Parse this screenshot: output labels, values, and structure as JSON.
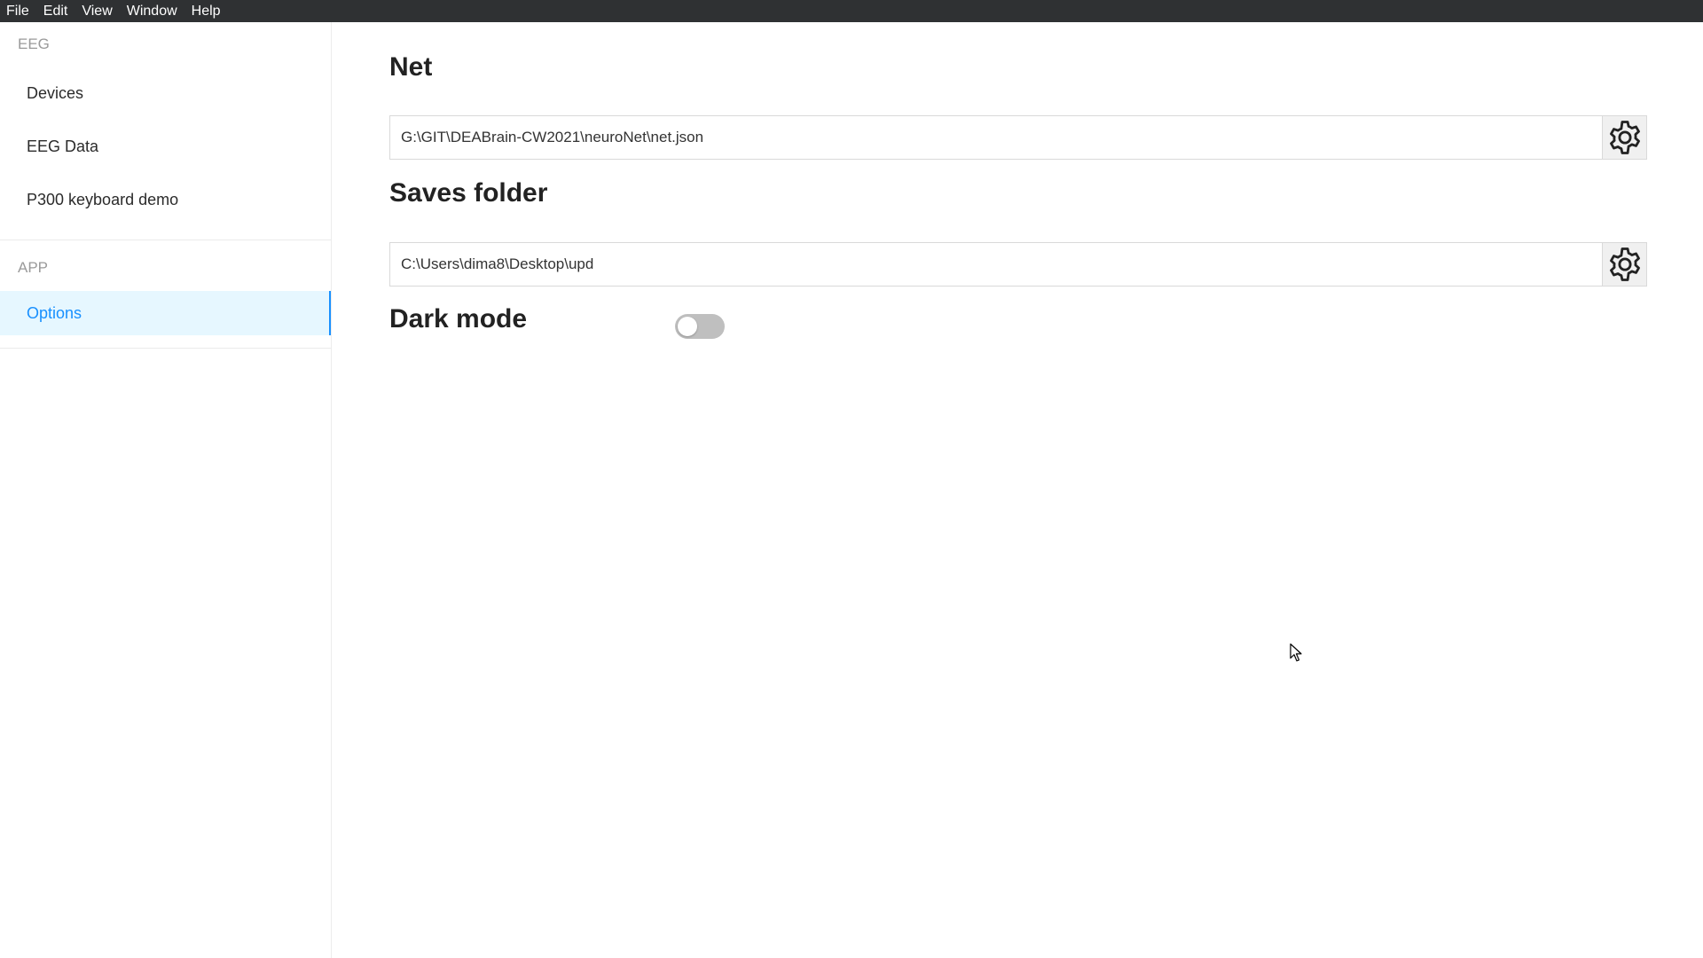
{
  "menubar": {
    "items": [
      "File",
      "Edit",
      "View",
      "Window",
      "Help"
    ]
  },
  "sidebar": {
    "eeg_section": "EEG",
    "eeg_items": [
      "Devices",
      "EEG Data",
      "P300 keyboard demo"
    ],
    "app_section": "APP",
    "app_items": [
      "Options"
    ],
    "active_item": "Options"
  },
  "main": {
    "net": {
      "title": "Net",
      "path": "G:\\GIT\\DEABrain-CW2021\\neuroNet\\net.json",
      "button_icon": "gear-icon"
    },
    "saves_folder": {
      "title": "Saves folder",
      "path": "C:\\Users\\dima8\\Desktop\\upd",
      "button_icon": "gear-icon"
    },
    "dark_mode": {
      "title": "Dark mode",
      "enabled": false
    }
  },
  "colors": {
    "menubar_bg": "#2f3133",
    "accent": "#1890ff",
    "active_bg": "#e6f7ff",
    "toggle_off": "#bfbfbf"
  }
}
